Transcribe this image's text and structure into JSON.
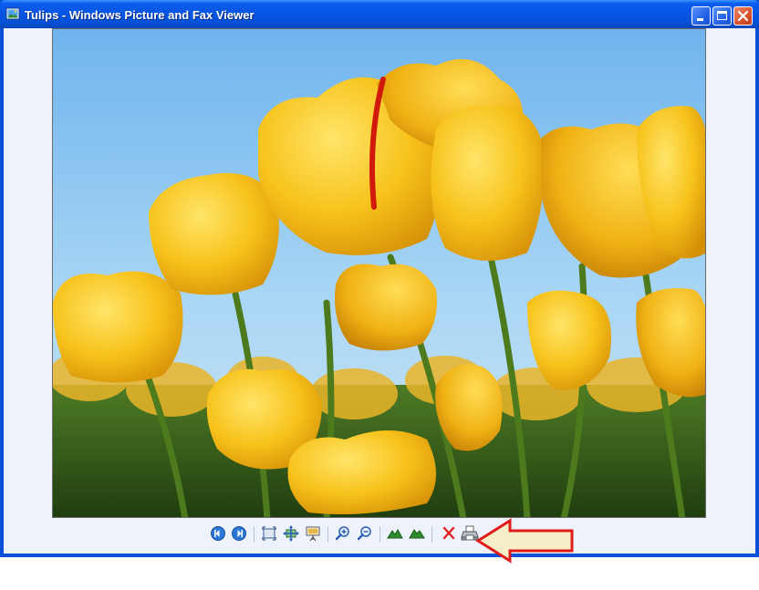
{
  "window": {
    "title": "Tulips - Windows Picture and Fax Viewer",
    "app_icon": "picture-viewer-icon",
    "caption_buttons": [
      "minimize-icon",
      "maximize-icon",
      "close-icon"
    ]
  },
  "image": {
    "subject": "photo-of-yellow-tulips"
  },
  "toolbar": {
    "buttons": [
      {
        "name": "previous-image-button",
        "icon": "previous-icon"
      },
      {
        "name": "next-image-button",
        "icon": "next-icon"
      },
      {
        "name": "best-fit-button",
        "icon": "best-fit-icon"
      },
      {
        "name": "actual-size-button",
        "icon": "actual-size-icon"
      },
      {
        "name": "slideshow-button",
        "icon": "slideshow-icon"
      },
      {
        "name": "zoom-in-button",
        "icon": "zoom-in-icon"
      },
      {
        "name": "zoom-out-button",
        "icon": "zoom-out-icon"
      },
      {
        "name": "rotate-clockwise-button",
        "icon": "rotate-clockwise-icon"
      },
      {
        "name": "rotate-counterclockwise-button",
        "icon": "rotate-counterclockwise-icon"
      },
      {
        "name": "delete-button",
        "icon": "delete-icon"
      },
      {
        "name": "print-button",
        "icon": "print-icon"
      }
    ]
  },
  "annotation": {
    "arrow": "callout-arrow-pointing-at-print",
    "colors": {
      "fill": "#f5eec6",
      "stroke": "#e01b1b"
    }
  },
  "colors": {
    "titlebar": "#0656e4",
    "client_background": "#eef2fb",
    "close_button": "#d9512d"
  }
}
